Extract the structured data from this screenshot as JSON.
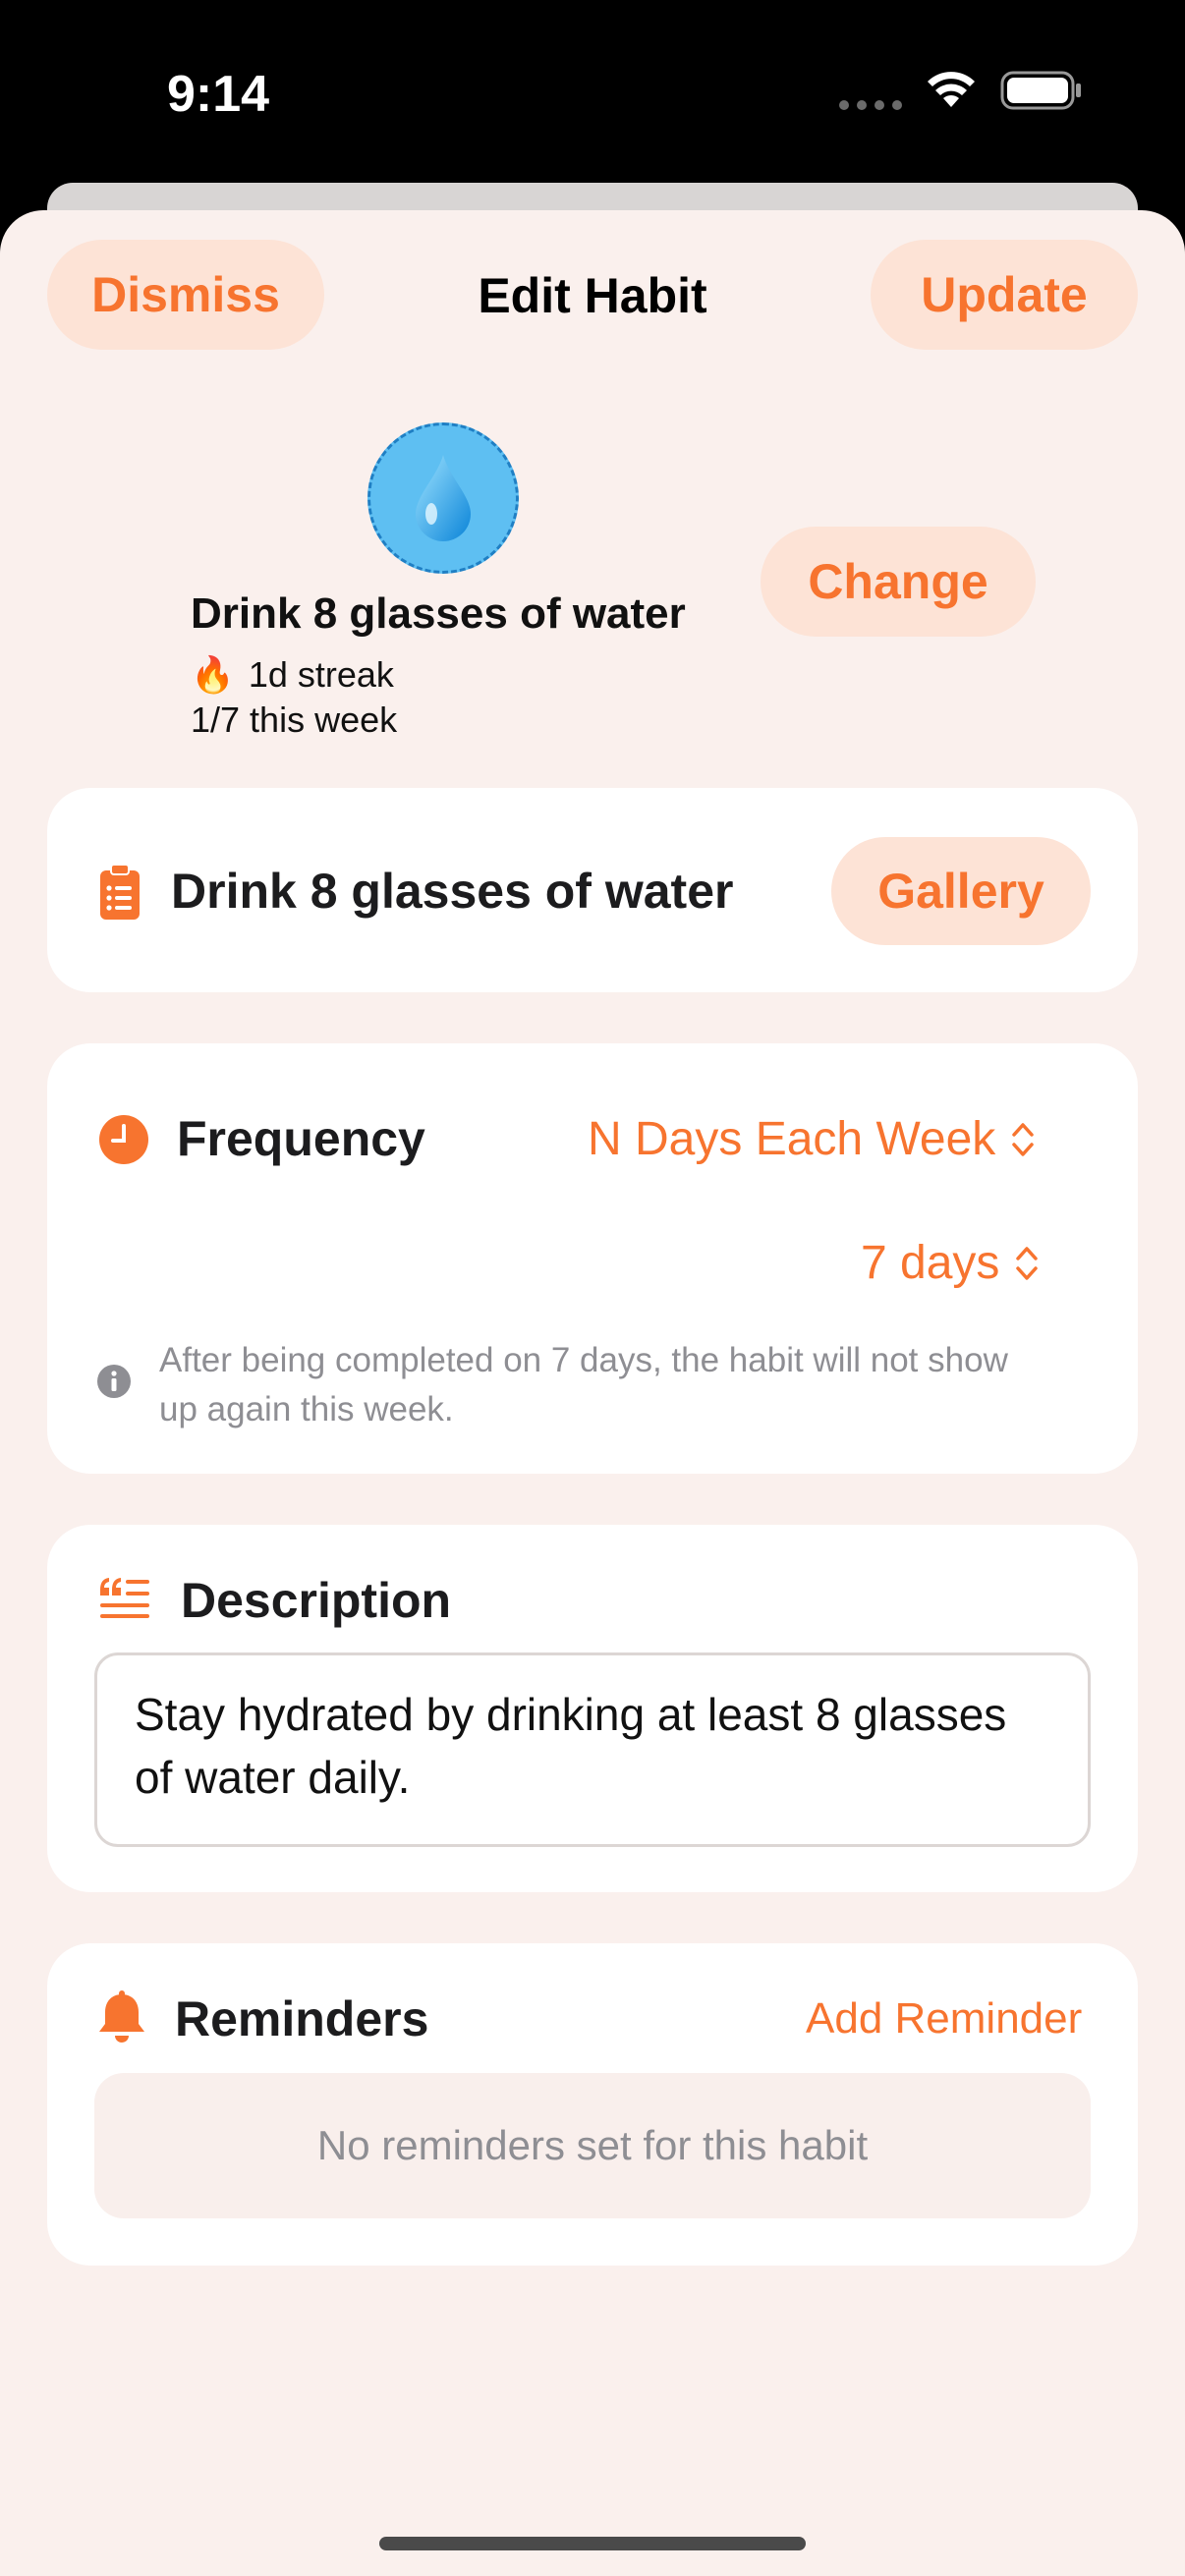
{
  "status_bar": {
    "time": "9:14"
  },
  "nav": {
    "dismiss_label": "Dismiss",
    "title": "Edit Habit",
    "update_label": "Update"
  },
  "habit": {
    "icon": "droplet-icon",
    "name": "Drink 8 glasses of water",
    "streak_emoji": "🔥",
    "streak": "1d streak",
    "week_progress": "1/7 this week",
    "change_label": "Change"
  },
  "name_card": {
    "icon": "clipboard-icon",
    "value": "Drink 8 glasses of water",
    "gallery_label": "Gallery"
  },
  "frequency": {
    "icon": "clock-icon",
    "title": "Frequency",
    "mode": "N Days Each Week",
    "days": "7 days",
    "info": "After being completed on 7 days, the habit will not show up again this week."
  },
  "description": {
    "icon": "quote-list-icon",
    "title": "Description",
    "text": "Stay hydrated by drinking at least 8 glasses of water daily."
  },
  "reminders": {
    "icon": "bell-icon",
    "title": "Reminders",
    "add_label": "Add Reminder",
    "empty_text": "No reminders set for this habit"
  },
  "colors": {
    "accent": "#f7742f",
    "accent_soft": "#fde3d6",
    "background": "#faf0ed",
    "card": "#ffffff",
    "secondary_text": "#8e8e93"
  }
}
